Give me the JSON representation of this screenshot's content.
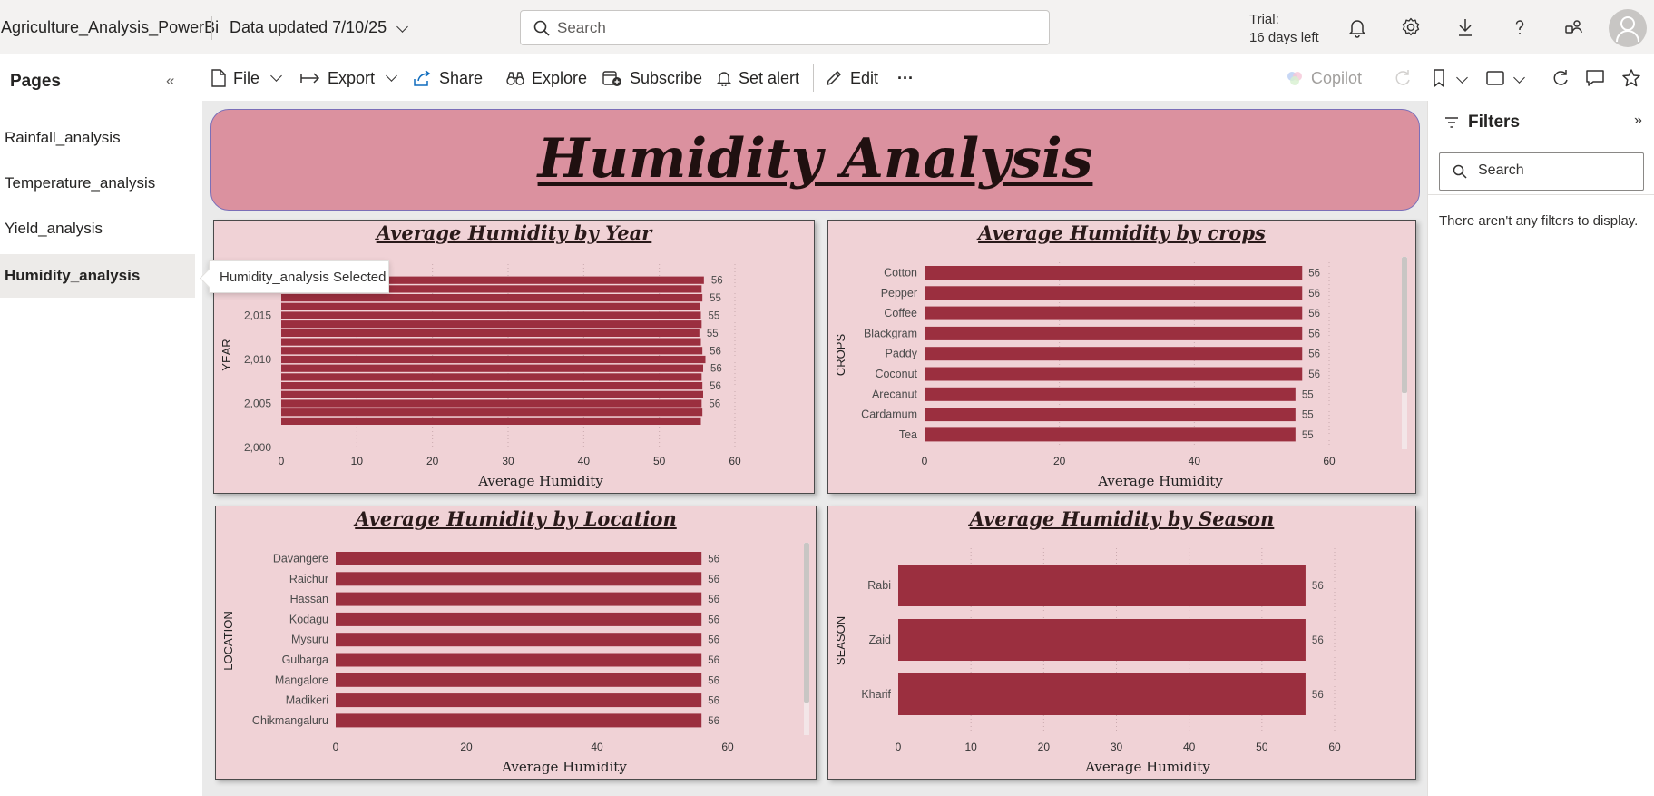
{
  "header": {
    "app_title": "Agriculture_Analysis_PowerBi",
    "data_updated": "Data updated 7/10/25",
    "search_placeholder": "Search",
    "trial_line1": "Trial:",
    "trial_line2": "16 days left",
    "icons": [
      "bell-icon",
      "gear-icon",
      "download-icon",
      "help-icon",
      "share-people-icon",
      "user-avatar-icon"
    ]
  },
  "pages_pane": {
    "title": "Pages",
    "items": [
      {
        "label": "Rainfall_analysis",
        "selected": false
      },
      {
        "label": "Temperature_analysis",
        "selected": false
      },
      {
        "label": "Yield_analysis",
        "selected": false
      },
      {
        "label": "Humidity_analysis",
        "selected": true
      }
    ],
    "tooltip": "Humidity_analysis Selected"
  },
  "toolbar": {
    "file": "File",
    "export": "Export",
    "share": "Share",
    "explore": "Explore",
    "subscribe": "Subscribe",
    "set_alert": "Set alert",
    "edit": "Edit",
    "more": "···",
    "copilot": "Copilot"
  },
  "report": {
    "banner_title": "Humidity Analysis"
  },
  "filters": {
    "title": "Filters",
    "search_placeholder": "Search",
    "empty_message": "There aren't any filters to display."
  },
  "colors": {
    "bar": "#9b2f3f",
    "card_bg": "#f0d2d6",
    "banner_bg": "#db919f"
  },
  "chart_data": [
    {
      "type": "bar",
      "orientation": "horizontal",
      "title": "Average Humidity by Year",
      "xlabel": "Average Humidity",
      "ylabel": "YEAR",
      "xlim": [
        0,
        60
      ],
      "x_ticks": [
        "0",
        "10",
        "20",
        "30",
        "40",
        "50",
        "60"
      ],
      "y_ticks": [
        "2,000",
        "2,005",
        "2,010",
        "2,015"
      ],
      "categories": [
        2019,
        2018,
        2017,
        2016,
        2015,
        2014,
        2013,
        2012,
        2011,
        2010,
        2009,
        2008,
        2007,
        2006,
        2005,
        2004,
        2003
      ],
      "values": [
        55.9,
        55.6,
        55.7,
        55.4,
        55.5,
        55.6,
        55.3,
        55.5,
        55.7,
        56.1,
        55.8,
        55.6,
        55.7,
        55.8,
        55.6,
        55.7,
        55.5
      ],
      "data_labels": [
        {
          "category": 2019,
          "text": "56"
        },
        {
          "category": 2017,
          "text": "55"
        },
        {
          "category": 2015,
          "text": "55"
        },
        {
          "category": 2013,
          "text": "55"
        },
        {
          "category": 2011,
          "text": "56"
        },
        {
          "category": 2009,
          "text": "56"
        },
        {
          "category": 2007,
          "text": "56"
        },
        {
          "category": 2005,
          "text": "56"
        }
      ]
    },
    {
      "type": "bar",
      "orientation": "horizontal",
      "title": "Average Humidity by crops",
      "xlabel": "Average Humidity",
      "ylabel": "CROPS",
      "xlim": [
        0,
        60
      ],
      "x_ticks": [
        "0",
        "20",
        "40",
        "60"
      ],
      "categories": [
        "Cotton",
        "Pepper",
        "Coffee",
        "Blackgram",
        "Paddy",
        "Coconut",
        "Arecanut",
        "Cardamum",
        "Tea"
      ],
      "values": [
        56,
        56,
        56,
        56,
        56,
        56,
        55,
        55,
        55
      ],
      "value_labels": [
        "56",
        "56",
        "56",
        "56",
        "56",
        "56",
        "55",
        "55",
        "55"
      ]
    },
    {
      "type": "bar",
      "orientation": "horizontal",
      "title": "Average Humidity by Location",
      "xlabel": "Average Humidity",
      "ylabel": "LOCATION",
      "xlim": [
        0,
        60
      ],
      "x_ticks": [
        "0",
        "20",
        "40",
        "60"
      ],
      "categories": [
        "Davangere",
        "Raichur",
        "Hassan",
        "Kodagu",
        "Mysuru",
        "Gulbarga",
        "Mangalore",
        "Madikeri",
        "Chikmangaluru"
      ],
      "values": [
        56,
        56,
        56,
        56,
        56,
        56,
        56,
        56,
        56
      ],
      "value_labels": [
        "56",
        "56",
        "56",
        "56",
        "56",
        "56",
        "56",
        "56",
        "56"
      ]
    },
    {
      "type": "bar",
      "orientation": "horizontal",
      "title": "Average Humidity by Season",
      "xlabel": "Average Humidity",
      "ylabel": "SEASON",
      "xlim": [
        0,
        60
      ],
      "x_ticks": [
        "0",
        "10",
        "20",
        "30",
        "40",
        "50",
        "60"
      ],
      "categories": [
        "Rabi",
        "Zaid",
        "Kharif"
      ],
      "values": [
        56,
        56,
        56
      ],
      "value_labels": [
        "56",
        "56",
        "56"
      ]
    }
  ]
}
